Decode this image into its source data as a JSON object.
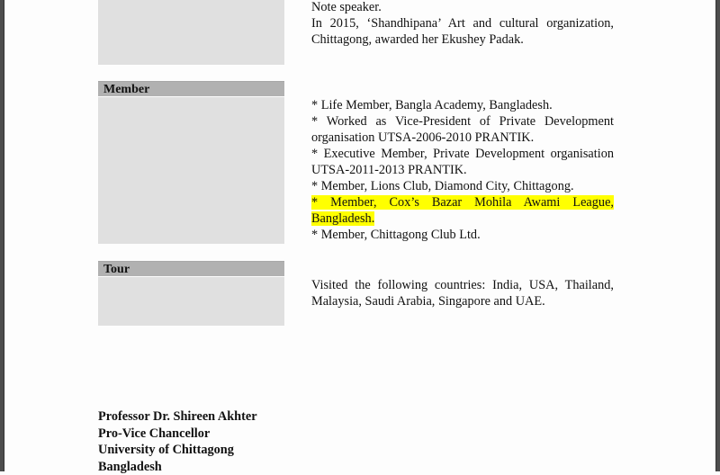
{
  "awards_section": {
    "lines": [
      "Note speaker.",
      "In 2015, ‘Shandhipana’ Art and cultural organization, Chittagong, awarded her Ekushey Padak."
    ]
  },
  "member_section": {
    "label": "Member",
    "items": [
      "* Life Member, Bangla Academy, Bangladesh.",
      "* Worked as Vice-President of Private Development organisation UTSA-2006-2010 PRANTIK.",
      "* Executive Member, Private Development organisation UTSA-2011-2013 PRANTIK.",
      "* Member, Lions Club, Diamond City, Chittagong.",
      "* Member, Cox’s Bazar Mohila Awami League, Bangladesh.",
      "* Member, Chittagong Club Ltd."
    ],
    "highlighted_item_index": 4,
    "highlight_color": "#ffff00"
  },
  "tour_section": {
    "label": "Tour",
    "text": "Visited the following countries: India, USA, Thailand, Malaysia, Saudi Arabia, Singapore and UAE."
  },
  "signature": {
    "name": "Professor Dr. Shireen Akhter",
    "title": "Pro-Vice Chancellor",
    "institution": "University of Chittagong",
    "country": "Bangladesh"
  },
  "colors": {
    "label_bar": "#b1b1b1",
    "label_box": "#e0e0e0",
    "frame": "#4d4d4d"
  }
}
